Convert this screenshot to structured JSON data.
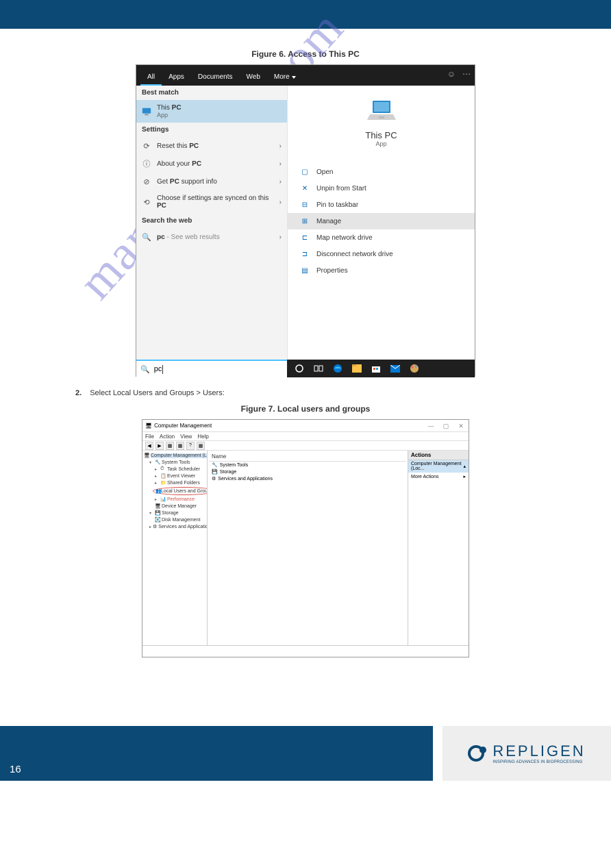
{
  "watermark": "manualshive.com",
  "figure6": {
    "heading": "Figure 6. Access to This PC",
    "tabs": [
      "All",
      "Apps",
      "Documents",
      "Web",
      "More"
    ],
    "top_icons": [
      "feedback",
      "more"
    ],
    "sections": {
      "best_match": "Best match",
      "settings": "Settings",
      "search_web": "Search the web"
    },
    "best_match_item": {
      "title_prefix": "This ",
      "title_bold": "PC",
      "sub": "App"
    },
    "settings_items": [
      {
        "text_prefix": "Reset this ",
        "text_bold": "PC"
      },
      {
        "text_prefix": "About your ",
        "text_bold": "PC"
      },
      {
        "text_prefix": "Get ",
        "text_bold": "PC",
        "text_suffix": " support info"
      },
      {
        "text_prefix": "Choose if settings are synced on this ",
        "text_multiline_bold": "PC"
      }
    ],
    "web_item": {
      "query": "pc",
      "hint": " - See web results"
    },
    "preview": {
      "title": "This PC",
      "sub": "App"
    },
    "actions": [
      {
        "label": "Open",
        "icon": "open"
      },
      {
        "label": "Unpin from Start",
        "icon": "unpin"
      },
      {
        "label": "Pin to taskbar",
        "icon": "pin"
      },
      {
        "label": "Manage",
        "icon": "manage",
        "highlight": true
      },
      {
        "label": "Map network drive",
        "icon": "map"
      },
      {
        "label": "Disconnect network drive",
        "icon": "disconnect"
      },
      {
        "label": "Properties",
        "icon": "properties"
      }
    ],
    "search_text": "pc",
    "taskbar_icons": [
      "cortana",
      "taskview",
      "edge",
      "files",
      "store",
      "mail",
      "paint"
    ]
  },
  "step2": {
    "num": "2.",
    "text": "Select Local Users and Groups > Users:"
  },
  "figure7": {
    "heading": "Figure 7. Local users and groups",
    "window_title": "Computer Management",
    "menus": [
      "File",
      "Action",
      "View",
      "Help"
    ],
    "tree_root": "Computer Management (Local)",
    "tree": {
      "system_tools": "System Tools",
      "task_scheduler": "Task Scheduler",
      "event_viewer": "Event Viewer",
      "shared_folders": "Shared Folders",
      "local_users": "Local Users and Groups",
      "performance": "Performance",
      "device_manager": "Device Manager",
      "storage": "Storage",
      "disk_mgmt": "Disk Management",
      "services_apps": "Services and Applications"
    },
    "list_header": "Name",
    "list_items": [
      "System Tools",
      "Storage",
      "Services and Applications"
    ],
    "actions_header": "Actions",
    "actions_row1": "Computer Management (Loc...",
    "actions_row2": "More Actions"
  },
  "footer": {
    "page": "16",
    "logo": "REPLIGEN",
    "tagline": "INSPIRING ADVANCES IN BIOPROCESSING"
  }
}
